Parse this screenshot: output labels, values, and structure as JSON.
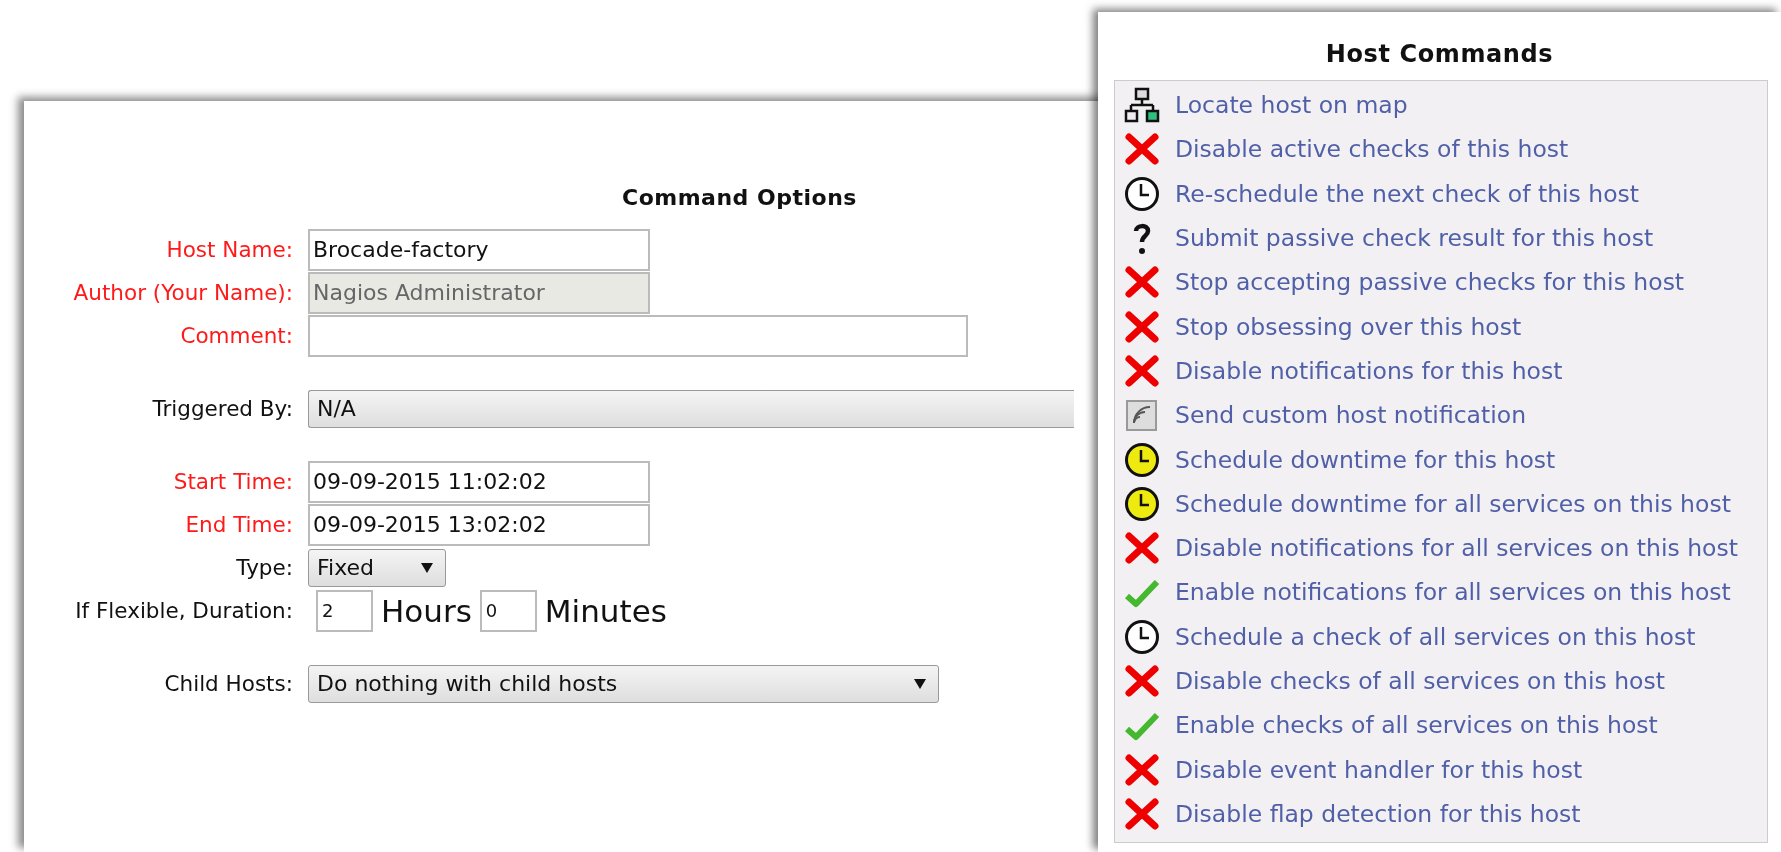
{
  "command_options": {
    "title": "Command Options",
    "groups": [
      [
        {
          "kind": "text",
          "label": "Host Name:",
          "required": true,
          "disabled": false,
          "value": "Brocade-factory"
        },
        {
          "kind": "text",
          "label": "Author (Your Name):",
          "required": true,
          "disabled": true,
          "value": "Nagios Administrator"
        },
        {
          "kind": "wide_text",
          "label": "Comment:",
          "required": true,
          "disabled": false
        }
      ],
      [
        {
          "kind": "cut_select",
          "label": "Triggered By:",
          "required": false,
          "value": "N/A"
        }
      ],
      [
        {
          "kind": "text",
          "label": "Start Time:",
          "required": true,
          "disabled": false,
          "value": "09-09-2015 11:02:02"
        },
        {
          "kind": "text",
          "label": "End Time:",
          "required": true,
          "disabled": false,
          "value": "09-09-2015 13:02:02"
        },
        {
          "kind": "short_select",
          "label": "Type:",
          "required": false,
          "value": "Fixed"
        },
        {
          "kind": "duration",
          "label": "If Flexible, Duration:",
          "required": false,
          "hours": "2",
          "hours_unit": "Hours",
          "minutes": "0",
          "minutes_unit": "Minutes"
        }
      ],
      [
        {
          "kind": "select",
          "label": "Child Hosts:",
          "required": false,
          "value": "Do nothing with child hosts"
        }
      ]
    ]
  },
  "host_commands": {
    "title": "Host Commands",
    "items": [
      {
        "kind": "map",
        "label": "Locate host on map"
      },
      {
        "kind": "cross",
        "label": "Disable active checks of this host"
      },
      {
        "kind": "clock",
        "label": "Re-schedule the next check of this host"
      },
      {
        "kind": "question",
        "label": "Submit passive check result for this host"
      },
      {
        "kind": "cross",
        "label": "Stop accepting passive checks for this host"
      },
      {
        "kind": "cross",
        "label": "Stop obsessing over this host"
      },
      {
        "kind": "cross",
        "label": "Disable notifications for this host"
      },
      {
        "kind": "signal",
        "label": "Send custom host notification"
      },
      {
        "kind": "downtime",
        "label": "Schedule downtime for this host"
      },
      {
        "kind": "downtime",
        "label": "Schedule downtime for all services on this host"
      },
      {
        "kind": "cross",
        "label": "Disable notifications for all services on this host"
      },
      {
        "kind": "check",
        "label": "Enable notifications for all services on this host"
      },
      {
        "kind": "clock",
        "label": "Schedule a check of all services on this host"
      },
      {
        "kind": "cross",
        "label": "Disable checks of all services on this host"
      },
      {
        "kind": "check",
        "label": "Enable checks of all services on this host"
      },
      {
        "kind": "cross",
        "label": "Disable event handler for this host"
      },
      {
        "kind": "cross",
        "label": "Disable flap detection for this host"
      }
    ]
  }
}
